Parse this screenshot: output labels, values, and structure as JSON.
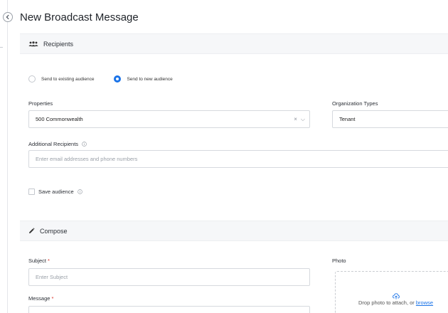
{
  "page": {
    "title": "New Broadcast Message"
  },
  "sections": {
    "recipients": {
      "title": "Recipients",
      "icon": "people-icon"
    },
    "compose": {
      "title": "Compose",
      "icon": "pencil-icon"
    }
  },
  "audience": {
    "options": [
      {
        "label": "Send to existing audience",
        "selected": false
      },
      {
        "label": "Send to new audience",
        "selected": true
      }
    ]
  },
  "properties": {
    "label": "Properties",
    "value": "500 Commonwealth",
    "clear_glyph": "×",
    "chevron_glyph": "⌵"
  },
  "organization_types": {
    "label": "Organization Types",
    "value": "Tenant"
  },
  "additional_recipients": {
    "label": "Additional Recipients",
    "placeholder": "Enter email addresses and phone numbers"
  },
  "save_audience": {
    "label": "Save audience",
    "checked": false
  },
  "subject": {
    "label": "Subject",
    "required_mark": "*",
    "placeholder": "Enter Subject"
  },
  "message": {
    "label": "Message",
    "required_mark": "*"
  },
  "photo": {
    "label": "Photo",
    "drop_text": "Drop photo to attach, or ",
    "browse_label": "browse"
  },
  "colors": {
    "accent": "#1a73e8",
    "required": "#d93025",
    "header_bg": "#f6f7f9"
  }
}
